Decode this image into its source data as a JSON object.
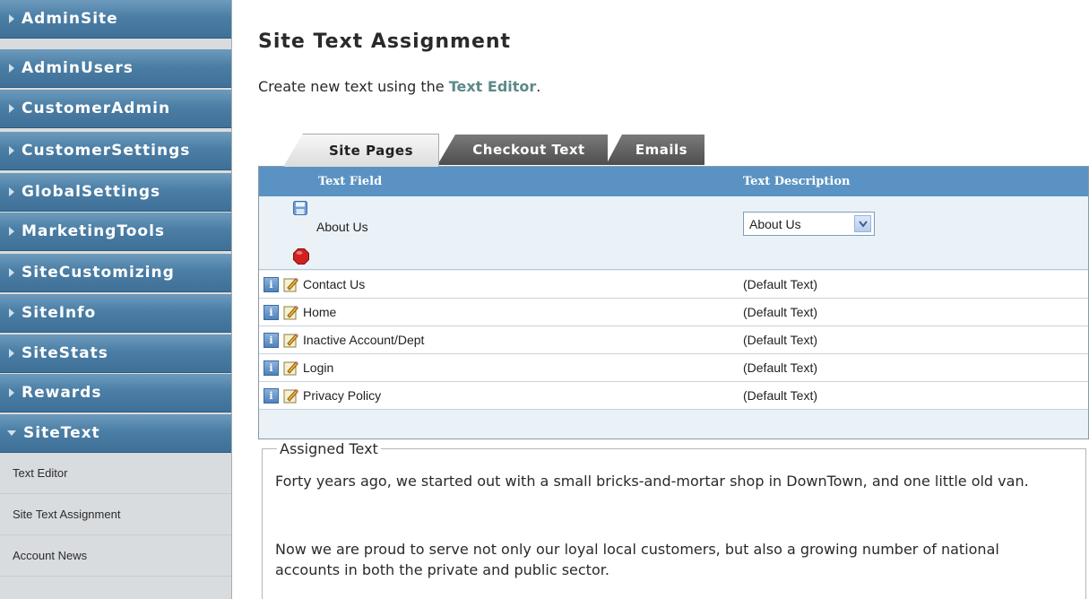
{
  "sidebar": {
    "items": [
      {
        "label": "AdminSite"
      },
      {
        "label": "AdminUsers"
      },
      {
        "label": "CustomerAdmin"
      },
      {
        "label": "CustomerSettings"
      },
      {
        "label": "GlobalSettings"
      },
      {
        "label": "MarketingTools"
      },
      {
        "label": "SiteCustomizing"
      },
      {
        "label": "SiteInfo"
      },
      {
        "label": "SiteStats"
      },
      {
        "label": "Rewards"
      },
      {
        "label": "SiteText"
      }
    ],
    "subitems": [
      {
        "label": "Text Editor"
      },
      {
        "label": "Site Text Assignment"
      },
      {
        "label": "Account News"
      }
    ]
  },
  "main": {
    "title": "Site Text Assignment",
    "intro_prefix": "Create new text using the ",
    "intro_link": "Text Editor",
    "intro_suffix": "."
  },
  "tabs": [
    {
      "label": "Site Pages",
      "active": true
    },
    {
      "label": "Checkout Text",
      "active": false
    },
    {
      "label": "Emails",
      "active": false
    }
  ],
  "grid": {
    "headers": {
      "text_field": "Text Field",
      "text_description": "Text Description"
    },
    "edit_row": {
      "name": "About Us",
      "selected_description": "About Us"
    },
    "rows": [
      {
        "field": "Contact Us",
        "description": "(Default Text)"
      },
      {
        "field": "Home",
        "description": "(Default Text)"
      },
      {
        "field": "Inactive Account/Dept",
        "description": "(Default Text)"
      },
      {
        "field": "Login",
        "description": "(Default Text)"
      },
      {
        "field": "Privacy Policy",
        "description": "(Default Text)"
      }
    ]
  },
  "assigned": {
    "legend": "Assigned Text",
    "paragraphs": [
      "Forty years ago, we started out with a small bricks-and-mortar shop in DownTown, and one little old van.",
      "Now we are proud to serve not only our loyal local customers, but also a growing number of national accounts in both the private and public sector."
    ]
  },
  "colors": {
    "nav_blue": "#4b7ea5",
    "grid_header": "#5a93c3",
    "link": "#5c8a8a"
  }
}
